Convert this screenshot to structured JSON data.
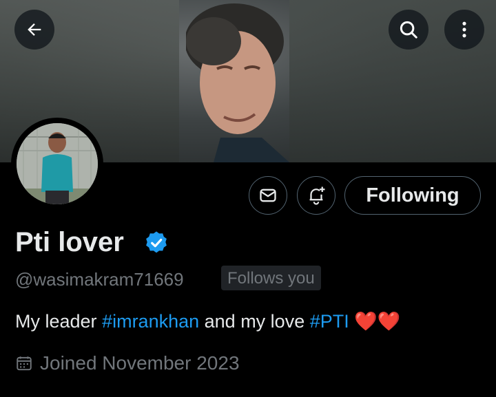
{
  "profile": {
    "name": "Pti lover",
    "handle": "@wasimakram71669",
    "follows_you": "Follows you",
    "bio": {
      "text1": "My leader ",
      "tag1": "#imrankhan",
      "text2": " and my love ",
      "tag2": "#PTI",
      "emoji": "❤️❤️"
    },
    "joined": "Joined November 2023"
  },
  "actions": {
    "following_label": "Following"
  },
  "icons": {
    "back": "arrow-left-icon",
    "search": "search-icon",
    "more": "more-vertical-icon",
    "message": "envelope-icon",
    "notify": "bell-plus-icon",
    "verified": "verified-badge-icon",
    "calendar": "calendar-icon"
  },
  "colors": {
    "background": "#000000",
    "link": "#1d9bf0",
    "muted": "#71767b",
    "text": "#e7e9ea",
    "verified": "#1d9bf0"
  }
}
